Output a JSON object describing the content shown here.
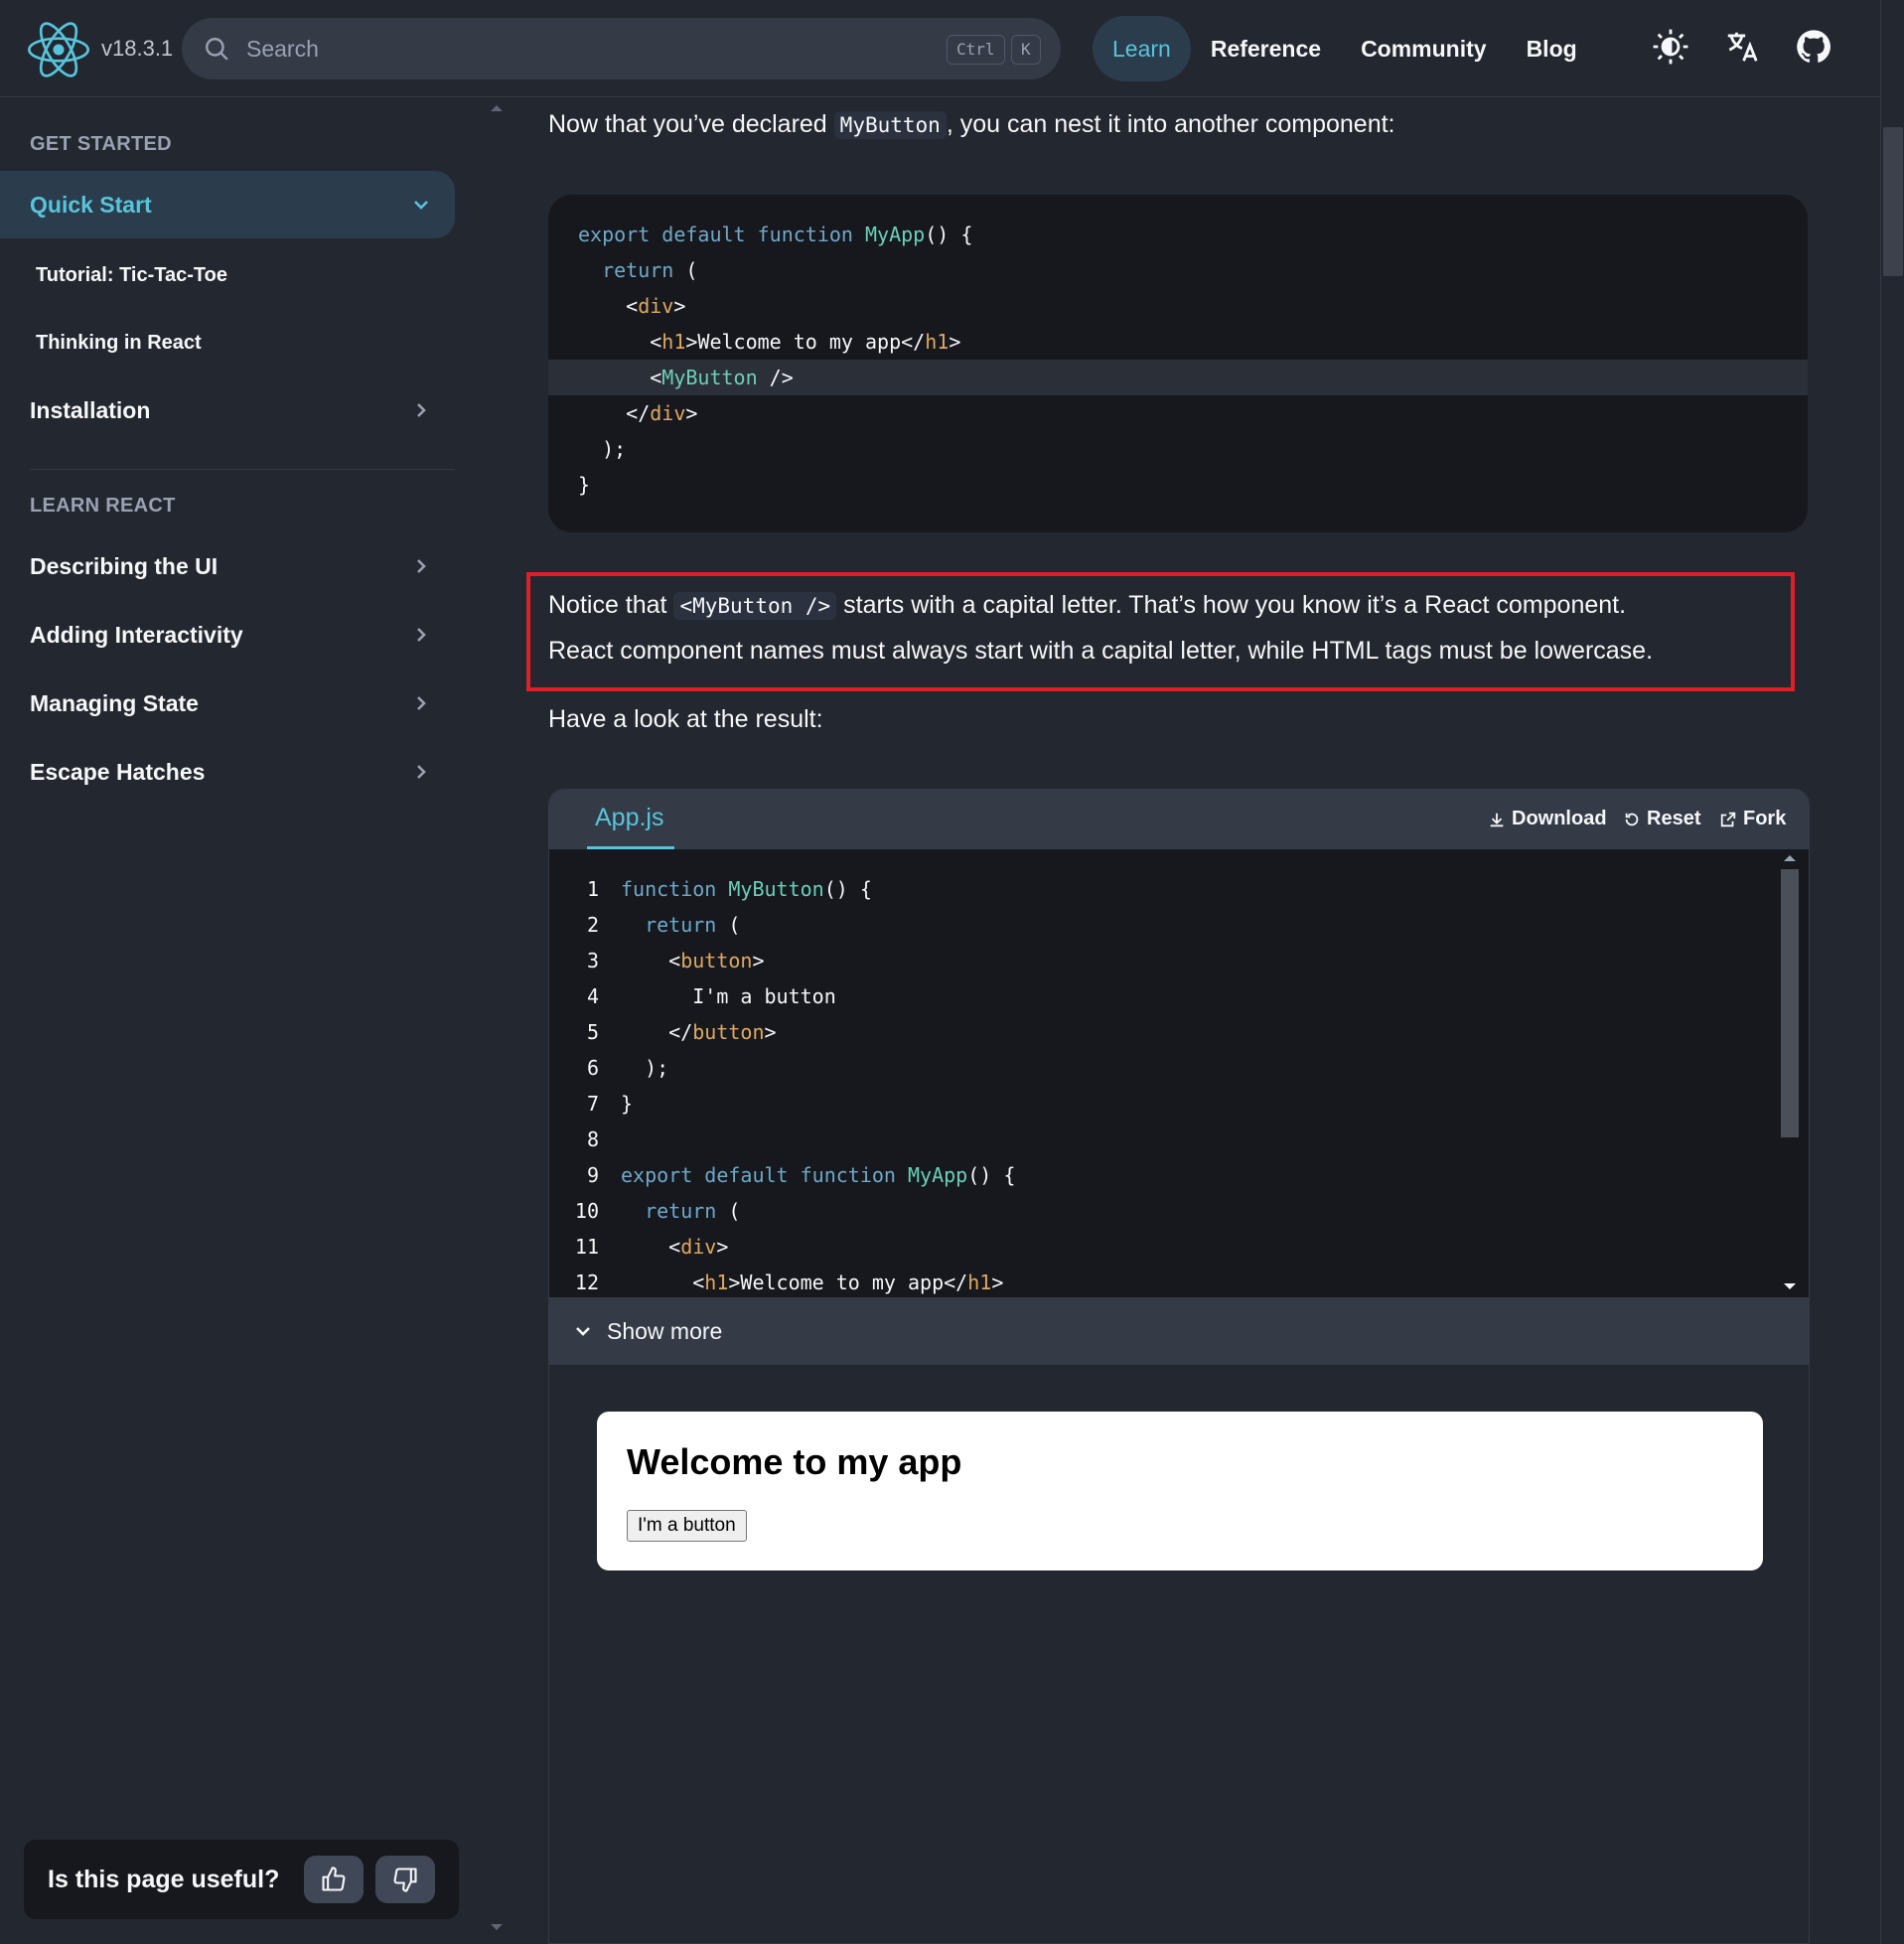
{
  "topnav": {
    "version": "v18.3.1",
    "search_placeholder": "Search",
    "kbd_ctrl": "Ctrl",
    "kbd_k": "K",
    "links": [
      "Learn",
      "Reference",
      "Community",
      "Blog"
    ],
    "active_link": "Learn",
    "icons": [
      "theme-toggle-icon",
      "language-icon",
      "github-icon"
    ]
  },
  "sidebar": {
    "section1": "GET STARTED",
    "quick_start": "Quick Start",
    "tutorial": "Tutorial: Tic-Tac-Toe",
    "thinking": "Thinking in React",
    "installation": "Installation",
    "section2": "LEARN REACT",
    "items": [
      "Describing the UI",
      "Adding Interactivity",
      "Managing State",
      "Escape Hatches"
    ],
    "feedback": "Is this page useful?"
  },
  "main": {
    "intro_before": "Now that you’ve declared",
    "intro_code": "MyButton",
    "intro_after": ", you can nest it into another component:",
    "code_lines": [
      "export default function MyApp() {",
      "  return (",
      "    <div>",
      "      <h1>Welcome to my app</h1>",
      "      <MyButton />",
      "    </div>",
      "  );",
      "}"
    ],
    "notice_before": "Notice that",
    "notice_code": "<MyButton />",
    "notice_after": "starts with a capital letter. That’s how you know it’s a React component.",
    "notice_line2": "React component names must always start with a capital letter, while HTML tags must be lowercase.",
    "result_text": "Have a look at the result:"
  },
  "sandpack": {
    "tab": "App.js",
    "download": "Download",
    "reset": "Reset",
    "fork": "Fork",
    "lines": [
      "function MyButton() {",
      "  return (",
      "    <button>",
      "      I'm a button",
      "    </button>",
      "  );",
      "}",
      "",
      "export default function MyApp() {",
      "  return (",
      "    <div>",
      "      <h1>Welcome to my app</h1>"
    ],
    "show_more": "Show more",
    "preview_title": "Welcome to my app",
    "preview_button": "I'm a button"
  },
  "colors": {
    "accent": "#58c4dc",
    "background": "#23272f",
    "code_bg": "#16181d",
    "highlight_border": "#e11f2b"
  }
}
